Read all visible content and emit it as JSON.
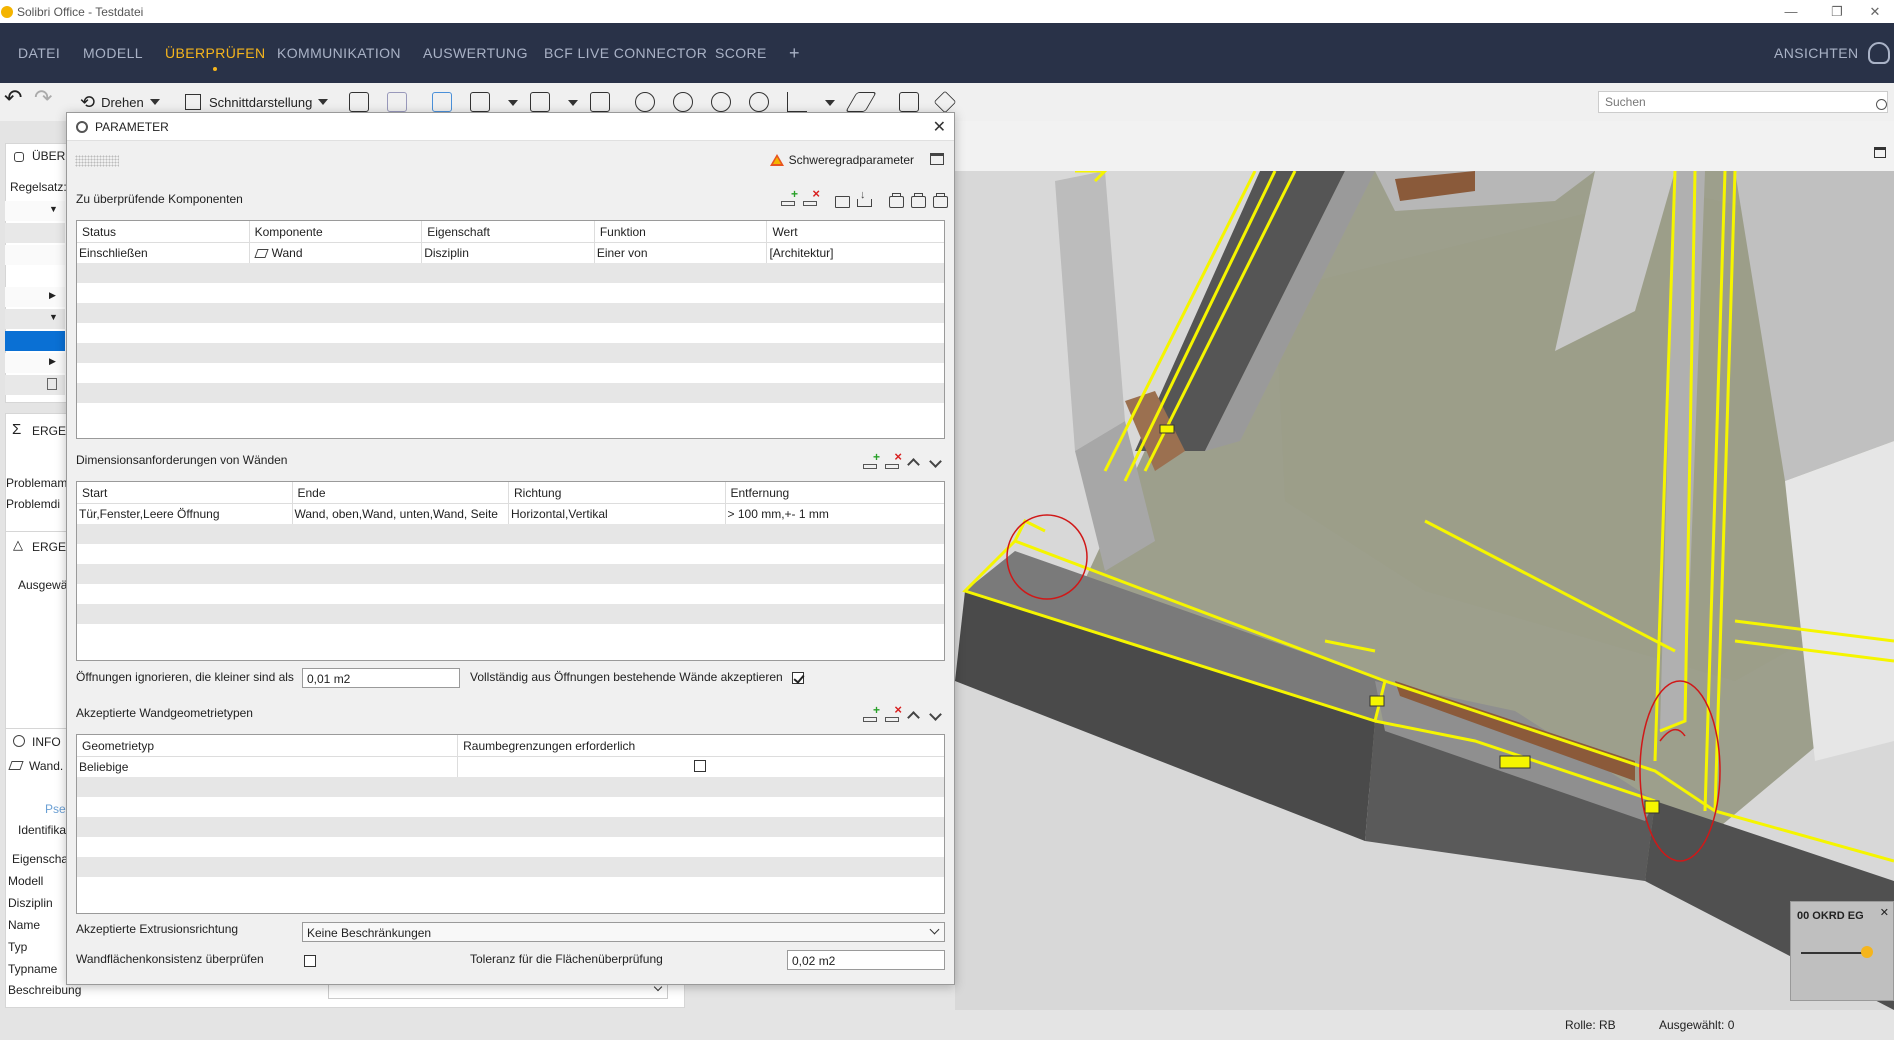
{
  "window": {
    "title": "Solibri Office - Testdatei"
  },
  "menu": {
    "items": [
      "DATEI",
      "MODELL",
      "ÜBERPRÜFEN",
      "KOMMUNIKATION",
      "AUSWERTUNG",
      "BCF LIVE CONNECTOR",
      "SCORE"
    ],
    "add": "+",
    "views": "ANSICHTEN"
  },
  "toolbar": {
    "rotate_label": "Drehen",
    "section_label": "Schnittdarstellung",
    "search_placeholder": "Suchen"
  },
  "left_panel": {
    "check_header": "ÜBER",
    "ruleset_label": "Regelsatz:",
    "results_header": "ERGE",
    "problem_name": "Problemam",
    "problem_desc": "Problemdi",
    "results2_header": "ERGE",
    "selected_label": "Ausgewä",
    "info_header": "INFO",
    "info_item": "Wand.",
    "info_tab": "Pse",
    "props": [
      "Identifika",
      "Eigenscha",
      "Modell",
      "Disziplin",
      "Name",
      "Typ",
      "Typname",
      "Beschreibung"
    ]
  },
  "statusbar": {
    "role": "Rolle: RB",
    "selected": "Ausgewählt: 0"
  },
  "viewport": {
    "label": "00 OKRD EG"
  },
  "dialog": {
    "title": "PARAMETER",
    "severity_label": "Schweregradparameter",
    "components": {
      "title": "Zu überprüfende Komponenten",
      "columns": [
        "Status",
        "Komponente",
        "Eigenschaft",
        "Funktion",
        "Wert"
      ],
      "rows": [
        [
          "Einschließen",
          "Wand",
          "Disziplin",
          "Einer von",
          "[Architektur]"
        ]
      ]
    },
    "dimensions": {
      "title": "Dimensionsanforderungen von Wänden",
      "columns": [
        "Start",
        "Ende",
        "Richtung",
        "Entfernung"
      ],
      "rows": [
        [
          "Tür,Fenster,Leere Öffnung",
          "Wand, oben,Wand, unten,Wand, Seite",
          "Horizontal,Vertikal",
          "> 100 mm,+- 1 mm"
        ]
      ]
    },
    "openings": {
      "ignore_label": "Öffnungen ignorieren, die kleiner sind als",
      "ignore_value": "0,01 m2",
      "accept_label": "Vollständig aus Öffnungen bestehende Wände akzeptieren",
      "accept_checked": true
    },
    "geometry": {
      "title": "Akzeptierte Wandgeometrietypen",
      "columns": [
        "Geometrietyp",
        "Raumbegrenzungen erforderlich"
      ],
      "rows": [
        [
          "Beliebige",
          false
        ]
      ]
    },
    "extrusion": {
      "label": "Akzeptierte Extrusionsrichtung",
      "value": "Keine Beschränkungen"
    },
    "surface": {
      "label": "Wandflächenkonsistenz überprüfen",
      "checked": false,
      "tolerance_label": "Toleranz für die Flächenüberprüfung",
      "tolerance_value": "0,02 m2"
    }
  },
  "colors": {
    "menu_bg": "#293248",
    "accent": "#f5b51d",
    "highlight": "#f5f500",
    "selection": "#0a70d4"
  }
}
